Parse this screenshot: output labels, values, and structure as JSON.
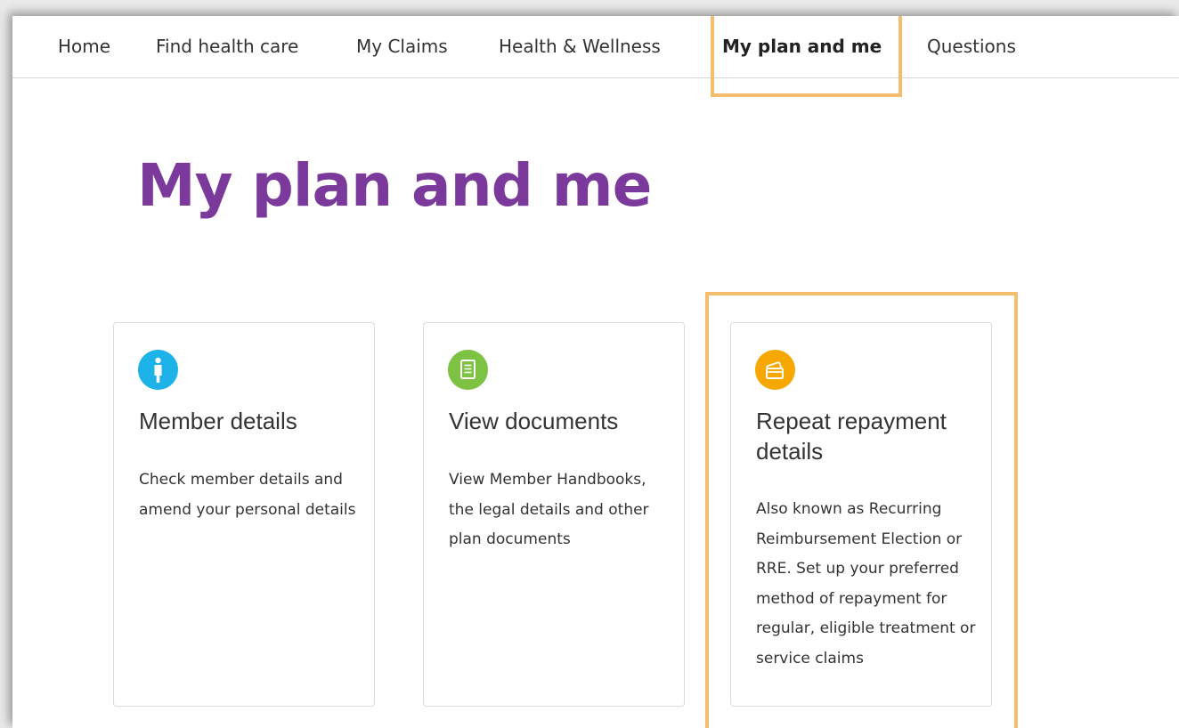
{
  "nav": {
    "items": [
      {
        "label": "Home"
      },
      {
        "label": "Find health care"
      },
      {
        "label": "My Claims"
      },
      {
        "label": "Health & Wellness"
      },
      {
        "label": "My plan and me",
        "active": true
      },
      {
        "label": "Questions"
      }
    ]
  },
  "page": {
    "title": "My plan and me"
  },
  "cards": [
    {
      "icon": "person-icon",
      "icon_color": "#1eb3e8",
      "title": "Member details",
      "description": "Check member details and amend your personal details"
    },
    {
      "icon": "document-icon",
      "icon_color": "#7dc242",
      "title": "View documents",
      "description": "View Member Handbooks, the legal details and other plan documents"
    },
    {
      "icon": "payment-card-icon",
      "icon_color": "#f7a800",
      "title": "Repeat repayment details",
      "description": "Also known as Recurring Reimbursement Election or RRE. Set up your preferred method of repayment for regular, eligible treatment or service claims"
    }
  ],
  "colors": {
    "title": "#7b3a9b",
    "highlight": "#f5bd6e"
  }
}
